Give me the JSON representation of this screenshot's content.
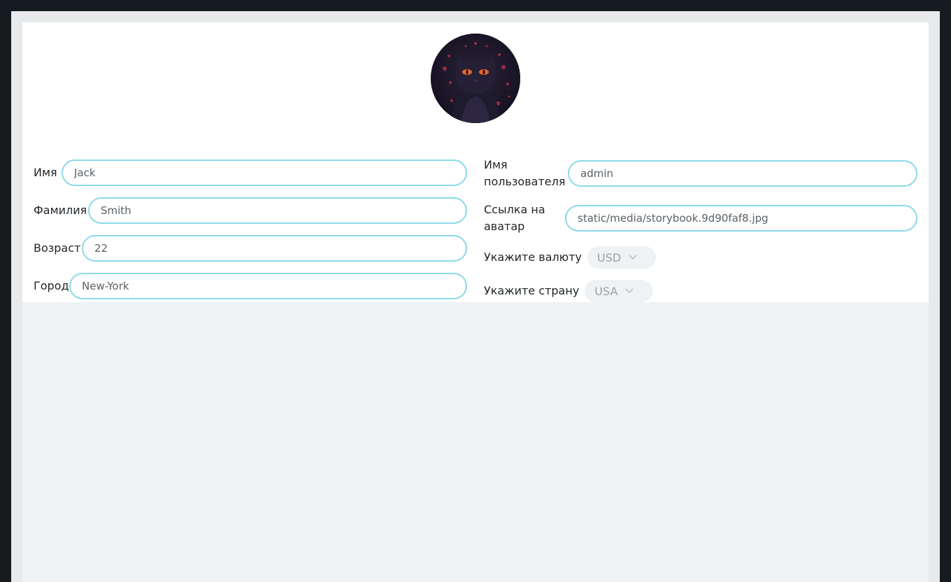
{
  "profile": {
    "avatar": {
      "alt": "cat-avatar"
    },
    "first_name": {
      "label": "Имя",
      "value": "Jack"
    },
    "last_name": {
      "label": "Фамилия",
      "value": "Smith"
    },
    "age": {
      "label": "Возраст",
      "value": "22"
    },
    "city": {
      "label": "Город",
      "value": "New-York"
    },
    "username": {
      "label": "Имя пользователя",
      "value": "admin"
    },
    "avatar_link": {
      "label": "Ссылка на аватар",
      "value": "static/media/storybook.9d90faf8.jpg"
    },
    "currency": {
      "label": "Укажите валюту",
      "value": "USD"
    },
    "country": {
      "label": "Укажите страну",
      "value": "USA"
    }
  },
  "colors": {
    "input_border": "#8bd9ea",
    "page_background": "#eef2f5",
    "frame_background": "#151b1f"
  },
  "icons": {
    "select_arrow": "chevron-down-icon"
  }
}
